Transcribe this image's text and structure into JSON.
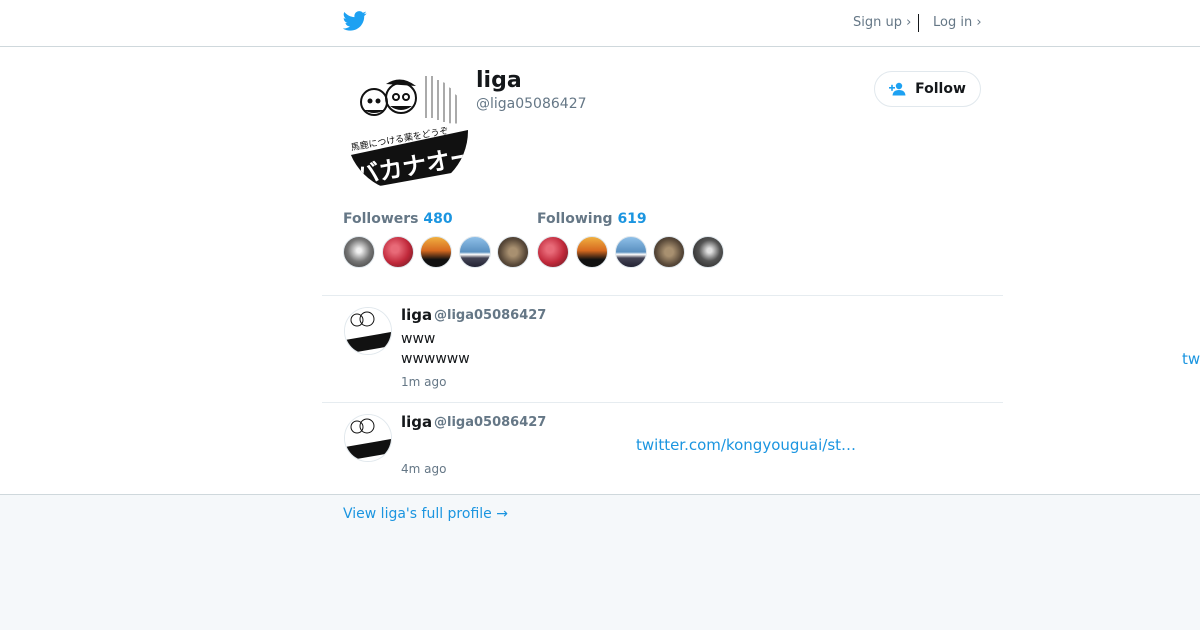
{
  "topbar": {
    "signup_label": "Sign up ›",
    "login_label": "Log in ›"
  },
  "profile": {
    "name": "liga",
    "handle": "@liga05086427",
    "follow_label": "Follow",
    "avatar_text": "バカナオー",
    "avatar_subtext": "馬鹿につける薬をどうぞ"
  },
  "stats": {
    "followers_label": "Followers",
    "followers_count": "480",
    "following_label": "Following",
    "following_count": "619"
  },
  "tweets": [
    {
      "name": "liga",
      "handle": "@liga05086427",
      "lines": [
        "www",
        "wwwwww"
      ],
      "time": "1m ago",
      "link": "tw"
    },
    {
      "name": "liga",
      "handle": "@liga05086427",
      "link": "twitter.com/kongyouguai/st…",
      "time": "4m ago"
    }
  ],
  "footer": {
    "full_profile_label": "View liga's full profile →"
  },
  "colors": {
    "accent": "#1b95e0",
    "twitter_blue": "#1da1f2",
    "muted": "#657786",
    "footer_bg": "#f5f8fa"
  }
}
